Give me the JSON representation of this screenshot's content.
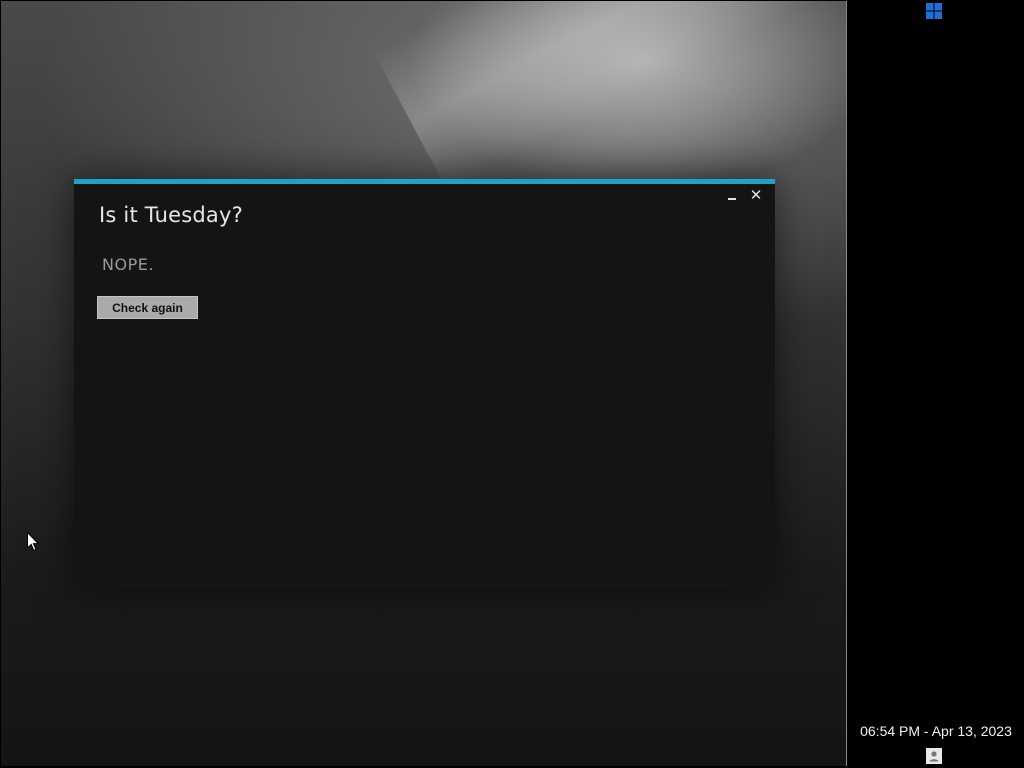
{
  "colors": {
    "accent": "#1ea2c8",
    "window_bg": "#141414",
    "taskbar_bg": "#000000",
    "start_icon": "#1e6fd6",
    "button_bg": "#aaaaaa"
  },
  "window": {
    "title": "Is it Tuesday?",
    "answer": "NOPE.",
    "check_button_label": "Check again",
    "minimize_icon": "minimize-icon",
    "close_icon": "close-icon",
    "close_glyph": "✕"
  },
  "taskbar": {
    "start_icon": "windows-start-icon",
    "clock": "06:54 PM - Apr 13, 2023",
    "user_icon": "user-icon"
  }
}
